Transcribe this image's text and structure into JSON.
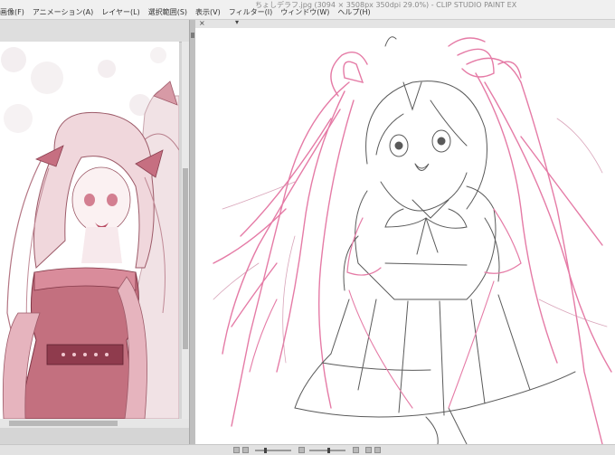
{
  "window": {
    "title": "ちょしデラフ.jpg (3094 × 3508px 350dpi 29.0%) - CLIP STUDIO PAINT EX"
  },
  "menu": {
    "items": [
      {
        "label": "画像(F)"
      },
      {
        "label": "アニメーション(A)"
      },
      {
        "label": "レイヤー(L)"
      },
      {
        "label": "選択範囲(S)"
      },
      {
        "label": "表示(V)"
      },
      {
        "label": "フィルター(I)"
      },
      {
        "label": "ウィンドウ(W)"
      },
      {
        "label": "ヘルプ(H)"
      }
    ]
  },
  "tabbar": {
    "close_glyph": "×",
    "menu_glyph": "▾"
  },
  "colors": {
    "sketch_pink": "#e57ba6",
    "sketch_gray": "#5a5a5a",
    "reference_fill": "#c3707f"
  },
  "icons": [
    "close-icon",
    "chevron-down-icon",
    "panel-grip-icon"
  ]
}
